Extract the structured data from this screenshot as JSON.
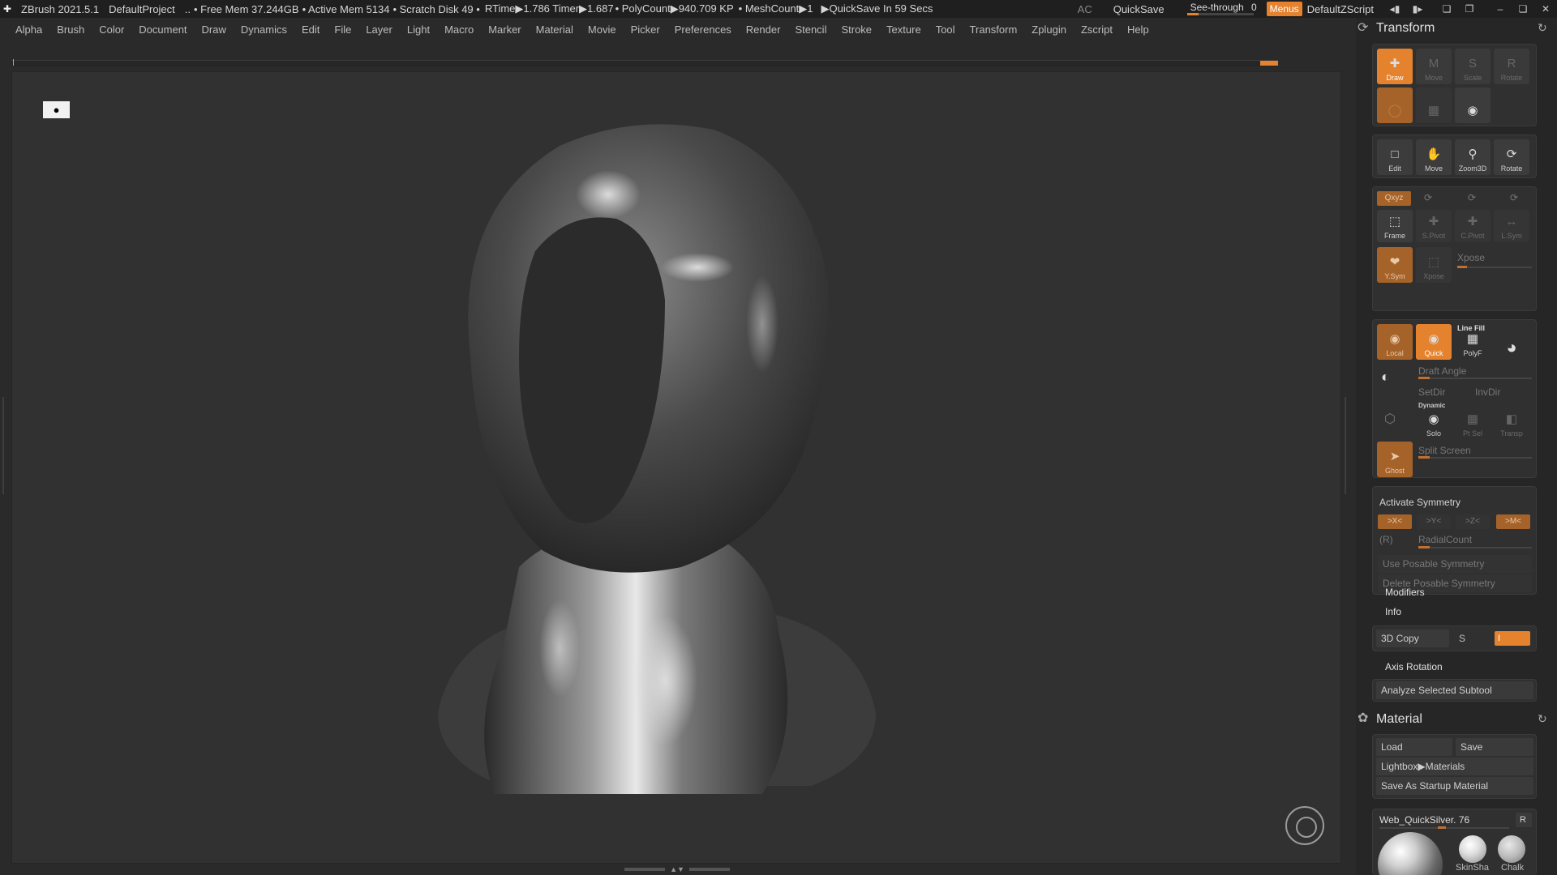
{
  "titlebar": {
    "app": "ZBrush 2021.5.1",
    "project": "DefaultProject",
    "dots": "..",
    "free_mem": "• Free Mem 37.244GB",
    "active_mem": "• Active Mem 5134",
    "scratch": "• Scratch Disk 49 •",
    "rtime": "RTime▶1.786 Timer▶1.687",
    "polycount": "• PolyCount▶940.709 KP",
    "meshcount": "• MeshCount▶1",
    "quicksave_in": "▶QuickSave In 59 Secs",
    "ac": "AC",
    "quicksave": "QuickSave",
    "see_through_label": "See-through",
    "see_through_value": "0",
    "menus": "Menus",
    "zscript": "DefaultZScript"
  },
  "menubar": [
    "Alpha",
    "Brush",
    "Color",
    "Document",
    "Draw",
    "Dynamics",
    "Edit",
    "File",
    "Layer",
    "Light",
    "Macro",
    "Marker",
    "Material",
    "Movie",
    "Picker",
    "Preferences",
    "Render",
    "Stencil",
    "Stroke",
    "Texture",
    "Tool",
    "Transform",
    "Zplugin",
    "Zscript",
    "Help"
  ],
  "transform": {
    "title": "Transform",
    "row1": [
      "Draw",
      "Move",
      "Scale",
      "Rotate"
    ],
    "row3": [
      "Edit",
      "Move",
      "Zoom3D",
      "Rotate"
    ],
    "xyz": "Qxyz",
    "frame_row": [
      "Frame",
      "S.Pivot",
      "C.Pivot",
      "L.Sym"
    ],
    "ysym": "Y.Sym",
    "xpose_btn": "Xpose",
    "xpose_label": "Xpose",
    "local": "Local",
    "quick": "Quick",
    "line_fill": "Line Fill",
    "polyf": "PolyF",
    "draft_angle": "Draft Angle",
    "setdir": "SetDir",
    "invdir": "InvDir",
    "dynamic": "Dynamic",
    "solo": "Solo",
    "ptsel": "Pt Sel",
    "transp": "Transp",
    "ghost": "Ghost",
    "split_screen": "Split Screen",
    "activate_symmetry": "Activate Symmetry",
    "sym_x": ">X<",
    "sym_y": ">Y<",
    "sym_z": ">Z<",
    "sym_m": ">M<",
    "r": "(R)",
    "radial": "RadialCount",
    "use_posable": "Use Posable Symmetry",
    "delete_posable": "Delete Posable Symmetry",
    "modifiers": "Modifiers",
    "info": "Info",
    "copy3d": "3D Copy",
    "s": "S",
    "i": "I",
    "axis_rotation": "Axis Rotation",
    "analyze": "Analyze Selected Subtool"
  },
  "material": {
    "title": "Material",
    "load": "Load",
    "save": "Save",
    "lightbox": "Lightbox▶Materials",
    "startup": "Save As Startup Material",
    "current": "Web_QuickSilver. 76",
    "r": "R",
    "skin": "SkinSha",
    "chalk": "Chalk"
  },
  "colors": {
    "accent": "#e5822e",
    "background": "#313131",
    "panel": "#262626"
  }
}
